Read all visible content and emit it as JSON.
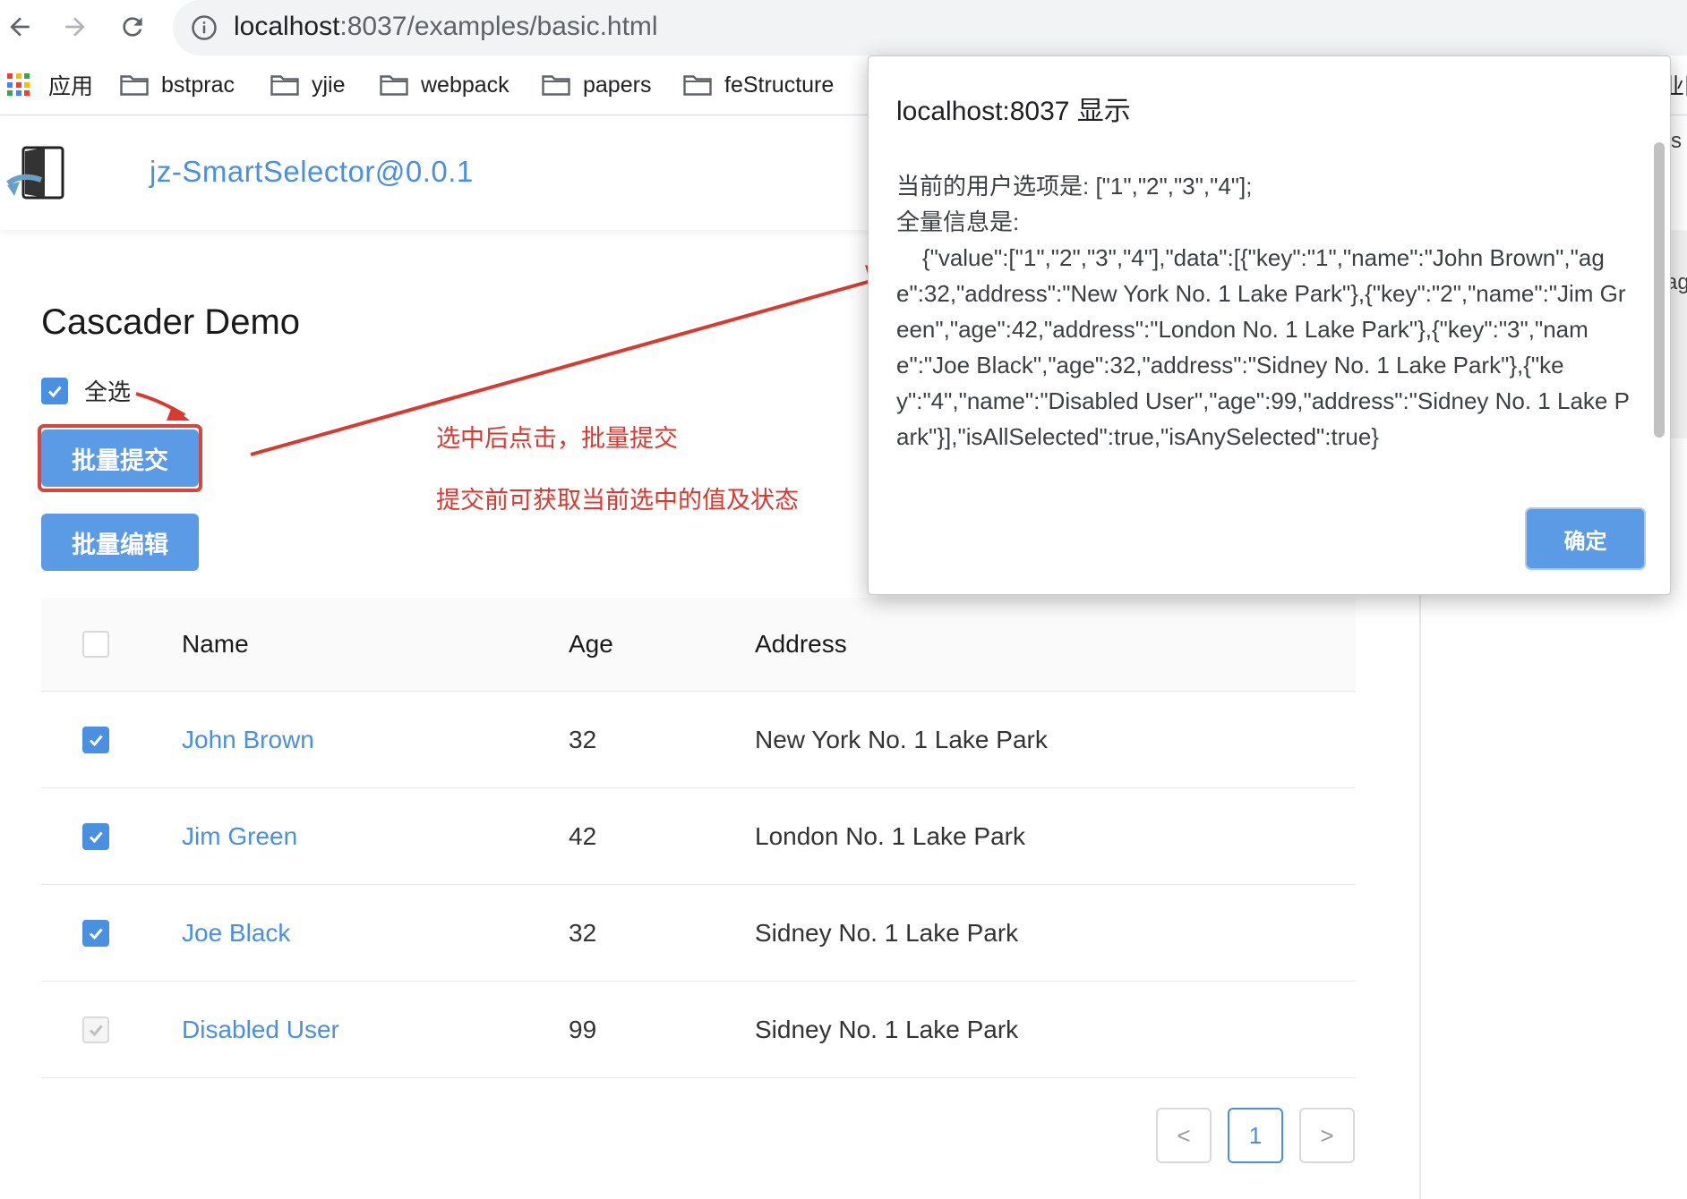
{
  "browser": {
    "url_host": "localhost",
    "url_rest": ":8037/examples/basic.html",
    "bookmarks": [
      {
        "label": "应用",
        "icon": "apps-grid-icon"
      },
      {
        "label": "bstprac",
        "icon": "folder-icon"
      },
      {
        "label": "yjie",
        "icon": "folder-icon"
      },
      {
        "label": "webpack",
        "icon": "folder-icon"
      },
      {
        "label": "papers",
        "icon": "folder-icon"
      },
      {
        "label": "feStructure",
        "icon": "folder-icon"
      }
    ],
    "bookmark_overflow_peek": "业队"
  },
  "header": {
    "brand": "jz-SmartSelector@0.0.1"
  },
  "page": {
    "title": "Cascader Demo",
    "select_all_label": "全选",
    "submit_button": "批量提交",
    "edit_button": "批量编辑"
  },
  "annotations": {
    "line1": "选中后点击，批量提交",
    "line2": "提交前可获取当前选中的值及状态",
    "color": "#d9392f"
  },
  "table": {
    "columns": [
      "Name",
      "Age",
      "Address"
    ],
    "rows": [
      {
        "name": "John Brown",
        "age": "32",
        "address": "New York No. 1 Lake Park",
        "checked": true,
        "disabled": false
      },
      {
        "name": "Jim Green",
        "age": "42",
        "address": "London No. 1 Lake Park",
        "checked": true,
        "disabled": false
      },
      {
        "name": "Joe Black",
        "age": "32",
        "address": "Sidney No. 1 Lake Park",
        "checked": true,
        "disabled": false
      },
      {
        "name": "Disabled User",
        "age": "99",
        "address": "Sidney No. 1 Lake Park",
        "checked": true,
        "disabled": true
      }
    ]
  },
  "pagination": {
    "prev": "<",
    "current": "1",
    "next": ">"
  },
  "right_panel_peek": {
    "line1": "s",
    "line2": "ag"
  },
  "dialog": {
    "title": "localhost:8037 显示",
    "message": "当前的用户选项是: [\"1\",\"2\",\"3\",\"4\"];\n全量信息是:\n    {\"value\":[\"1\",\"2\",\"3\",\"4\"],\"data\":[{\"key\":\"1\",\"name\":\"John Brown\",\"age\":32,\"address\":\"New York No. 1 Lake Park\"},{\"key\":\"2\",\"name\":\"Jim Green\",\"age\":42,\"address\":\"London No. 1 Lake Park\"},{\"key\":\"3\",\"name\":\"Joe Black\",\"age\":32,\"address\":\"Sidney No. 1 Lake Park\"},{\"key\":\"4\",\"name\":\"Disabled User\",\"age\":99,\"address\":\"Sidney No. 1 Lake Park\"}],\"isAllSelected\":true,\"isAnySelected\":true}",
    "ok_button": "确定"
  },
  "colors": {
    "primary": "#4a90e2",
    "button": "#5b9be6",
    "annotation_red": "#d9392f"
  }
}
